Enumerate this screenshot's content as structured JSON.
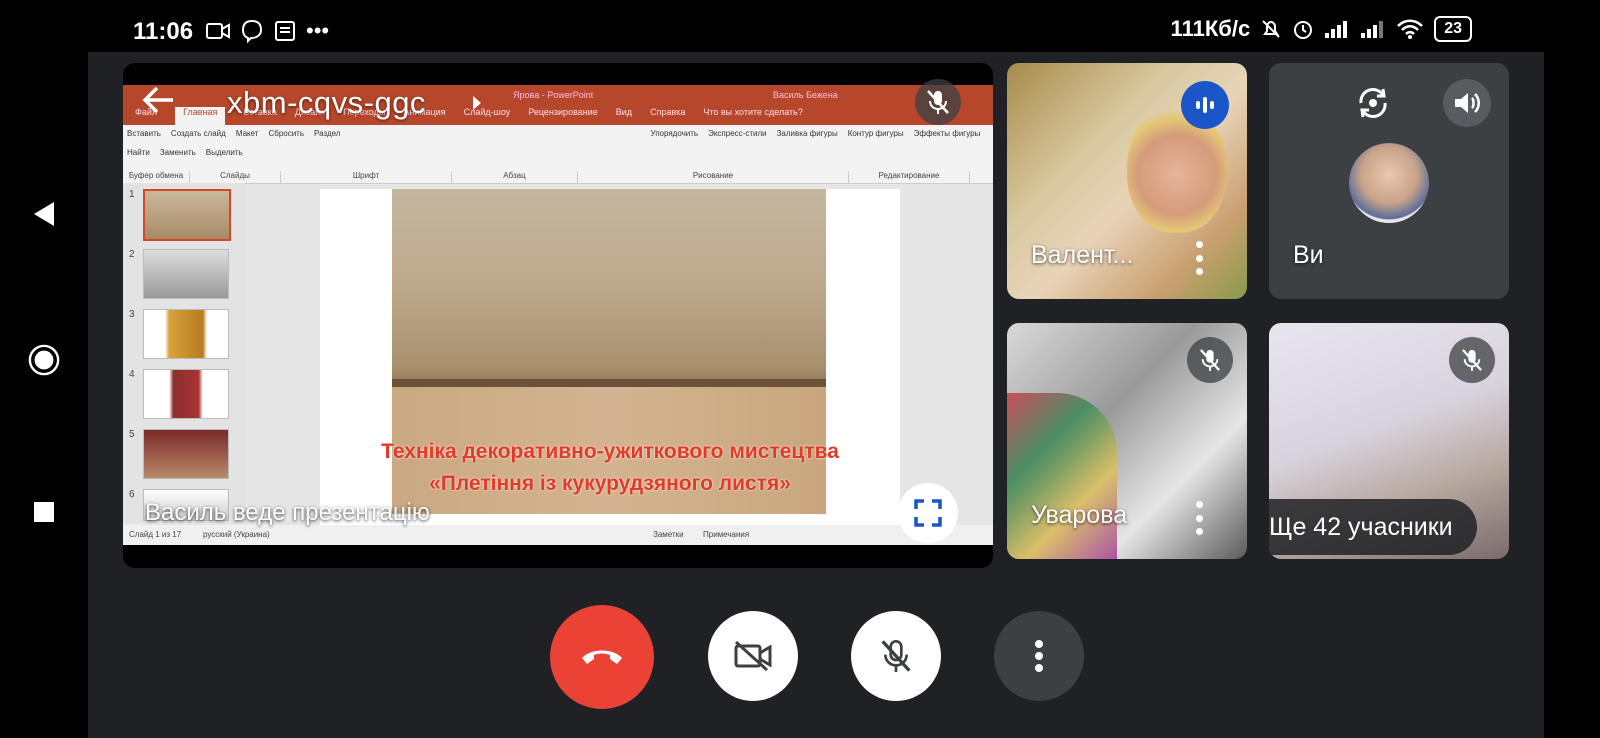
{
  "status_bar": {
    "time": "11:06",
    "left_icons": [
      "video-icon",
      "viber-icon",
      "news-icon",
      "more-dots"
    ],
    "speed": "111Кб/с",
    "battery": "23"
  },
  "presentation": {
    "meeting_code": "xbm-cqvs-ggc",
    "presenter_label": "Василь веде презентацію",
    "ppt": {
      "tabs": [
        "Файл",
        "Главная",
        "Вставка",
        "Дизайн",
        "Переходы",
        "Анимация",
        "Слайд-шоу",
        "Рецензирование",
        "Вид",
        "Справка",
        "Что вы хотите сделать?"
      ],
      "title": "Ярова - PowerPoint",
      "user": "Василь Бежена",
      "ribbon_groups": [
        "Буфер обмена",
        "Слайды",
        "Шрифт",
        "Абзац",
        "Рисование",
        "Редактирование"
      ],
      "ribbon_buttons": [
        "Вставить",
        "Создать слайд",
        "Макет",
        "Сбросить",
        "Раздел",
        "Упорядочить",
        "Экспресс-стили",
        "Заливка фигуры",
        "Контур фигуры",
        "Эффекты фигуры",
        "Найти",
        "Заменить",
        "Выделить"
      ],
      "thumb_numbers": [
        "1",
        "2",
        "3",
        "4",
        "5",
        "6"
      ],
      "slide_title_line1": "Техніка декоративно-ужиткового мистецтва",
      "slide_title_line2": "«Плетіння із кукурудзяного листя»",
      "status_left": "Слайд 1 из 17",
      "status_lang": "русский (Украина)",
      "status_notes": "Заметки",
      "status_comments": "Примечания"
    }
  },
  "tiles": [
    {
      "name": "Валент...",
      "speaking": true
    },
    {
      "name": "Ви"
    },
    {
      "name": "Уварова",
      "muted": true
    },
    {
      "more_label": "Ще 42 учасники",
      "muted": true
    }
  ],
  "colors": {
    "hangup": "#ea4335",
    "stage_bg": "#202124",
    "tile_bg": "#3c4043",
    "speaking_badge": "#1a56c8",
    "ppt_accent": "#b7472a",
    "slide_title": "#e33a28"
  }
}
